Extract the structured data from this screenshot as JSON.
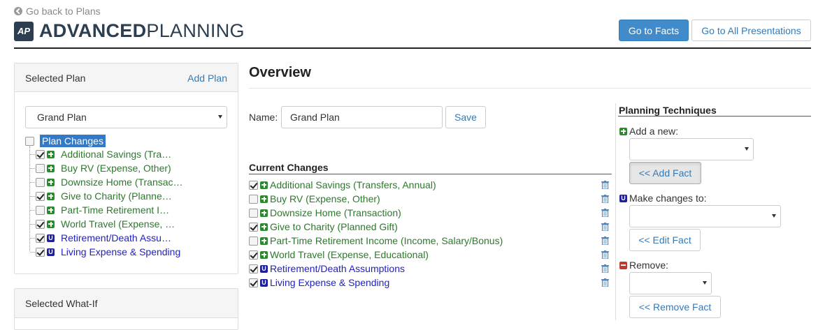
{
  "header": {
    "back_link": "Go back to Plans",
    "logo_badge": "AP",
    "logo_bold": "ADVANCED",
    "logo_light": "PLANNING",
    "go_to_facts": "Go to Facts",
    "go_to_all_presentations": "Go to All Presentations"
  },
  "sidebar": {
    "selected_plan_title": "Selected Plan",
    "add_plan": "Add Plan",
    "plan_select_value": "Grand Plan",
    "tree_root_label": "Plan Changes",
    "tree_items": [
      {
        "label": "Additional Savings (Tra…",
        "checked": true,
        "icon": "plus-icon",
        "color": "#2b7a2b"
      },
      {
        "label": "Buy RV (Expense, Other)",
        "checked": false,
        "icon": "plus-icon",
        "color": "#2b7a2b"
      },
      {
        "label": "Downsize Home (Transac…",
        "checked": false,
        "icon": "plus-icon",
        "color": "#2b7a2b"
      },
      {
        "label": "Give to Charity (Planne…",
        "checked": true,
        "icon": "plus-icon",
        "color": "#2b7a2b"
      },
      {
        "label": "Part-Time Retirement I…",
        "checked": false,
        "icon": "plus-icon",
        "color": "#2b7a2b"
      },
      {
        "label": "World Travel (Expense, …",
        "checked": true,
        "icon": "plus-icon",
        "color": "#2b7a2b"
      },
      {
        "label": "Retirement/Death Assu…",
        "checked": true,
        "icon": "update-icon",
        "color": "#2020c8"
      },
      {
        "label": "Living Expense & Spending",
        "checked": true,
        "icon": "update-icon",
        "color": "#2020c8"
      }
    ],
    "selected_whatif_title": "Selected What-If"
  },
  "overview": {
    "title": "Overview",
    "name_label": "Name:",
    "name_value": "Grand Plan",
    "save_label": "Save",
    "current_changes_title": "Current Changes",
    "changes": [
      {
        "label": "Additional Savings (Transfers, Annual)",
        "checked": true,
        "icon": "plus-icon"
      },
      {
        "label": "Buy RV (Expense, Other)",
        "checked": false,
        "icon": "plus-icon"
      },
      {
        "label": "Downsize Home (Transaction)",
        "checked": false,
        "icon": "plus-icon"
      },
      {
        "label": "Give to Charity (Planned Gift)",
        "checked": true,
        "icon": "plus-icon"
      },
      {
        "label": "Part-Time Retirement Income (Income, Salary/Bonus)",
        "checked": false,
        "icon": "plus-icon"
      },
      {
        "label": "World Travel (Expense, Educational)",
        "checked": true,
        "icon": "plus-icon"
      },
      {
        "label": "Retirement/Death Assumptions",
        "checked": true,
        "icon": "update-icon"
      },
      {
        "label": "Living Expense & Spending",
        "checked": true,
        "icon": "update-icon"
      }
    ]
  },
  "planning_techniques": {
    "title": "Planning Techniques",
    "add_label": "Add a new:",
    "add_button": "<< Add Fact",
    "edit_label": "Make changes to:",
    "edit_button": "<< Edit Fact",
    "remove_label": "Remove:",
    "remove_button": "<< Remove Fact"
  },
  "colors": {
    "primary": "#428bca",
    "link": "#337ab7",
    "add_green": "#2b7a2b",
    "update_blue": "#2020c8",
    "remove_red": "#c0392b",
    "selected_highlight": "#3279c7"
  }
}
